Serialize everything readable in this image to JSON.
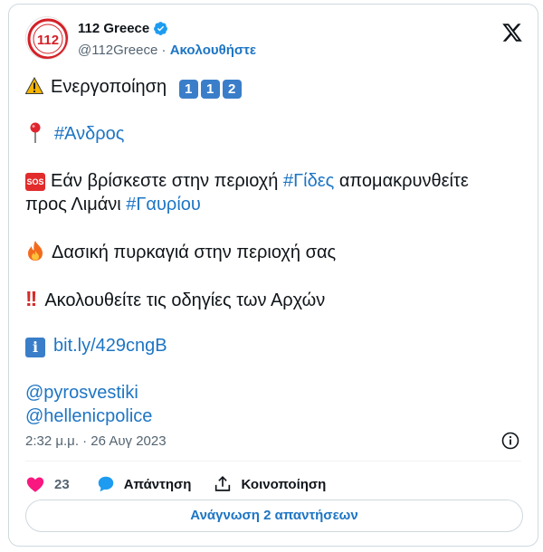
{
  "account": {
    "name": "112 Greece",
    "handle": "@112Greece",
    "separator": "·",
    "follow_label": "Ακολουθήστε",
    "avatar_text": "112"
  },
  "tweet": {
    "line1_text": "Ενεργοποίηση",
    "line1_keycaps": [
      "1",
      "1",
      "2"
    ],
    "line2_hashtag": "#Άνδρος",
    "sos_label": "SOS",
    "line3_a": "Εάν βρίσκεστε στην περιοχή",
    "line3_hashtag": "#Γίδες",
    "line3_b": "απομακρυνθείτε",
    "line4_a": "προς Λιμάνι",
    "line4_hashtag": "#Γαυρίου",
    "line5_text": "Δασική πυρκαγιά στην περιοχή σας",
    "line6_bang": "!!",
    "line6_text": "Ακολουθείτε τις οδηγίες των Αρχών",
    "info_glyph": "i",
    "link_text": "bit.ly/429cngB",
    "mention1": "@pyrosvestiki",
    "mention2": "@hellenicpolice"
  },
  "meta": {
    "timestamp": "2:32 μ.μ. · 26 Αυγ 2023"
  },
  "actions": {
    "like_count": "23",
    "reply_label": "Απάντηση",
    "share_label": "Κοινοποίηση"
  },
  "footer": {
    "read_replies_label": "Ανάγνωση 2 απαντήσεων"
  },
  "colors": {
    "link": "#1d75c4",
    "like": "#f91880",
    "reply": "#1d9bf0",
    "verified": "#1d9bf0",
    "muted": "#536471"
  },
  "icons": {
    "warning": "warning-icon",
    "pin": "round-pushpin-icon",
    "sos": "sos-icon",
    "fire": "fire-icon",
    "double_exclamation": "double-exclamation-icon",
    "info": "information-icon",
    "verified": "verified-badge-icon",
    "logo": "x-logo-icon",
    "info_circle": "info-circle-icon",
    "like": "heart-icon",
    "reply": "reply-bubble-icon",
    "share": "share-icon"
  }
}
